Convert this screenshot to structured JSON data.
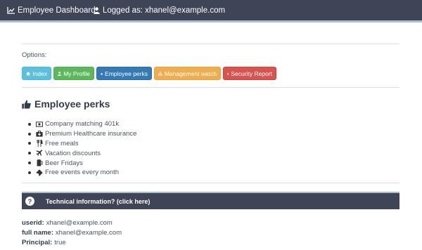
{
  "navbar": {
    "dashboard_label": "Employee Dashboard",
    "user_label": "Logged as: xhanel@example.com"
  },
  "options": {
    "label": "Options:",
    "buttons": [
      {
        "label": "Index",
        "icon": "home-icon"
      },
      {
        "label": "My Profile",
        "icon": "user-icon"
      },
      {
        "label": "Employee perks",
        "icon": "thumbs-up-icon"
      },
      {
        "label": "Management watch",
        "icon": "sitemap-icon"
      },
      {
        "label": "Security Report",
        "icon": "lock-icon"
      }
    ]
  },
  "perks": {
    "title": "Employee perks",
    "items": [
      {
        "label": "Company matching 401k",
        "icon": "money-icon"
      },
      {
        "label": "Premium Healthcare insurance",
        "icon": "medkit-icon"
      },
      {
        "label": "Free meals",
        "icon": "cutlery-icon"
      },
      {
        "label": "Vacation discounts",
        "icon": "plane-icon"
      },
      {
        "label": "Beer Fridays",
        "icon": "beer-icon"
      },
      {
        "label": "Free events every month",
        "icon": "ticket-icon"
      }
    ]
  },
  "tech": {
    "label": "Technical information? (click here)",
    "icon": "question-icon"
  },
  "info": {
    "userid_key": "userid:",
    "userid_value": "xhanel@example.com",
    "fullname_key": "full name:",
    "fullname_value": "xhanel@example.com",
    "principal_key": "Principal:",
    "principal_value": "true"
  },
  "colors": {
    "navbar": "#3f4457",
    "info": "#5bc0de",
    "success": "#5cb85c",
    "primary": "#337ab7",
    "warning": "#f0ad4e",
    "danger": "#d9534f"
  }
}
